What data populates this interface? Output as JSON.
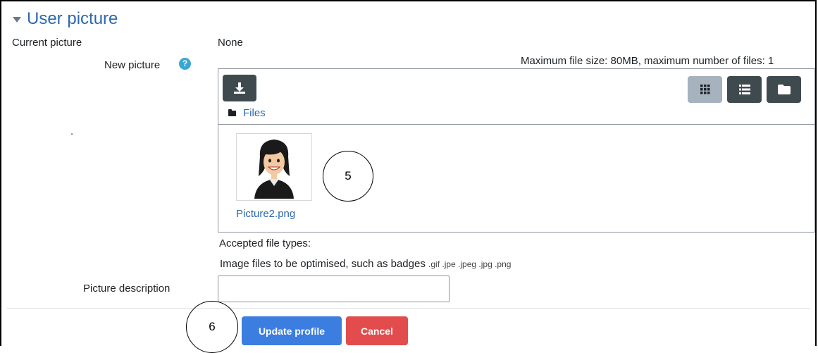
{
  "section": {
    "title": "User picture"
  },
  "current_picture": {
    "label": "Current picture",
    "value": "None"
  },
  "new_picture": {
    "label": "New picture",
    "help_icon": "question-circle-icon",
    "limits": "Maximum file size: 80MB, maximum number of files: 1"
  },
  "file_manager": {
    "path_label": "Files",
    "icons": {
      "download": "download-icon",
      "grid_view": "grid-view-icon",
      "list_view": "list-view-icon",
      "folder_view": "folder-view-icon",
      "folder": "folder-icon"
    },
    "files": [
      {
        "name": "Picture2.png"
      }
    ]
  },
  "accepted_types": {
    "label": "Accepted file types:",
    "description": "Image files to be optimised, such as badges",
    "extensions": ".gif .jpe .jpeg .jpg .png"
  },
  "picture_description": {
    "label": "Picture description",
    "value": ""
  },
  "annotations": {
    "callout_1": "5",
    "callout_2": "6"
  },
  "buttons": {
    "update": "Update profile",
    "cancel": "Cancel"
  },
  "stray_mark": ".",
  "colors": {
    "link": "#2d68b0",
    "primary": "#3c7de0",
    "danger": "#e34c4c",
    "dark_button": "#3f4a4f",
    "active_view": "#a6b2bd"
  }
}
